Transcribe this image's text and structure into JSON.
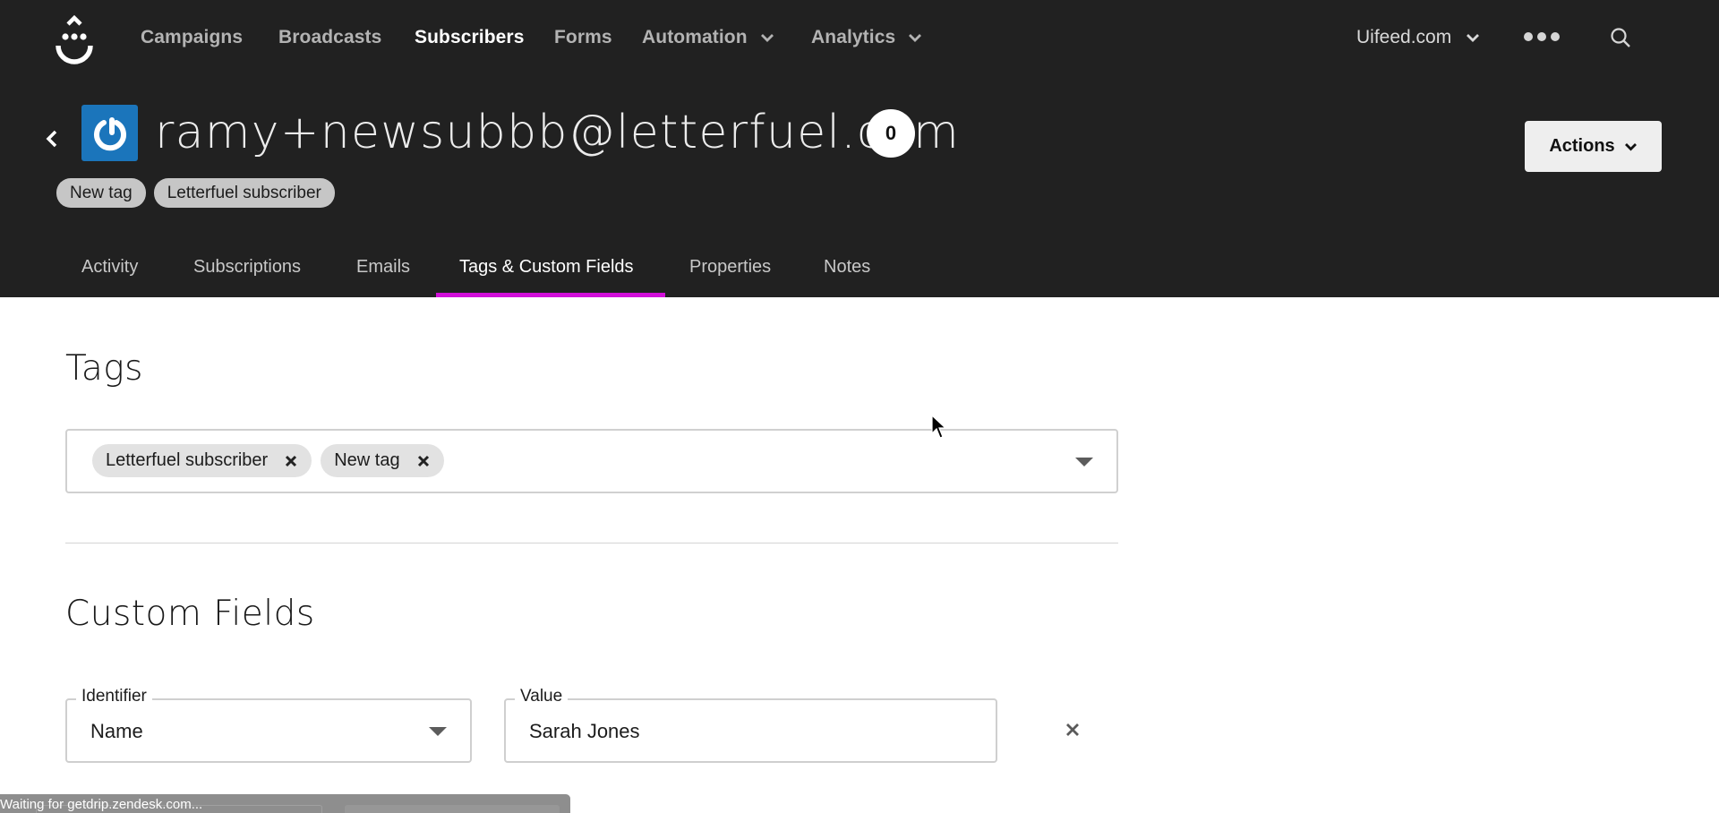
{
  "nav": {
    "logo_icon": "drip-smile-logo",
    "items": [
      {
        "label": "Campaigns",
        "active": false,
        "dropdown": false
      },
      {
        "label": "Broadcasts",
        "active": false,
        "dropdown": false
      },
      {
        "label": "Subscribers",
        "active": true,
        "dropdown": false
      },
      {
        "label": "Forms",
        "active": false,
        "dropdown": false
      },
      {
        "label": "Automation",
        "active": false,
        "dropdown": true
      },
      {
        "label": "Analytics",
        "active": false,
        "dropdown": true
      }
    ],
    "account": "Uifeed.com",
    "more_icon": "more-horizontal-icon",
    "search_icon": "search-icon"
  },
  "subscriber": {
    "email": "ramy+newsubbb@letterfuel.com",
    "score": "0",
    "avatar_icon": "power-icon",
    "avatar_color": "#1b75bb",
    "tags": [
      "New tag",
      "Letterfuel subscriber"
    ],
    "actions_label": "Actions"
  },
  "tabs": {
    "items": [
      "Activity",
      "Subscriptions",
      "Emails",
      "Tags & Custom Fields",
      "Properties",
      "Notes"
    ],
    "active_index": 3,
    "accent_color": "#d10fd9"
  },
  "tags_section": {
    "title": "Tags",
    "selected": [
      "Letterfuel subscriber",
      "New tag"
    ]
  },
  "custom_fields": {
    "title": "Custom Fields",
    "identifier_label": "Identifier",
    "identifier_value": "Name",
    "value_label": "Value",
    "value_value": "Sarah Jones"
  },
  "status_bar": {
    "text": "Waiting for getdrip.zendesk.com..."
  }
}
